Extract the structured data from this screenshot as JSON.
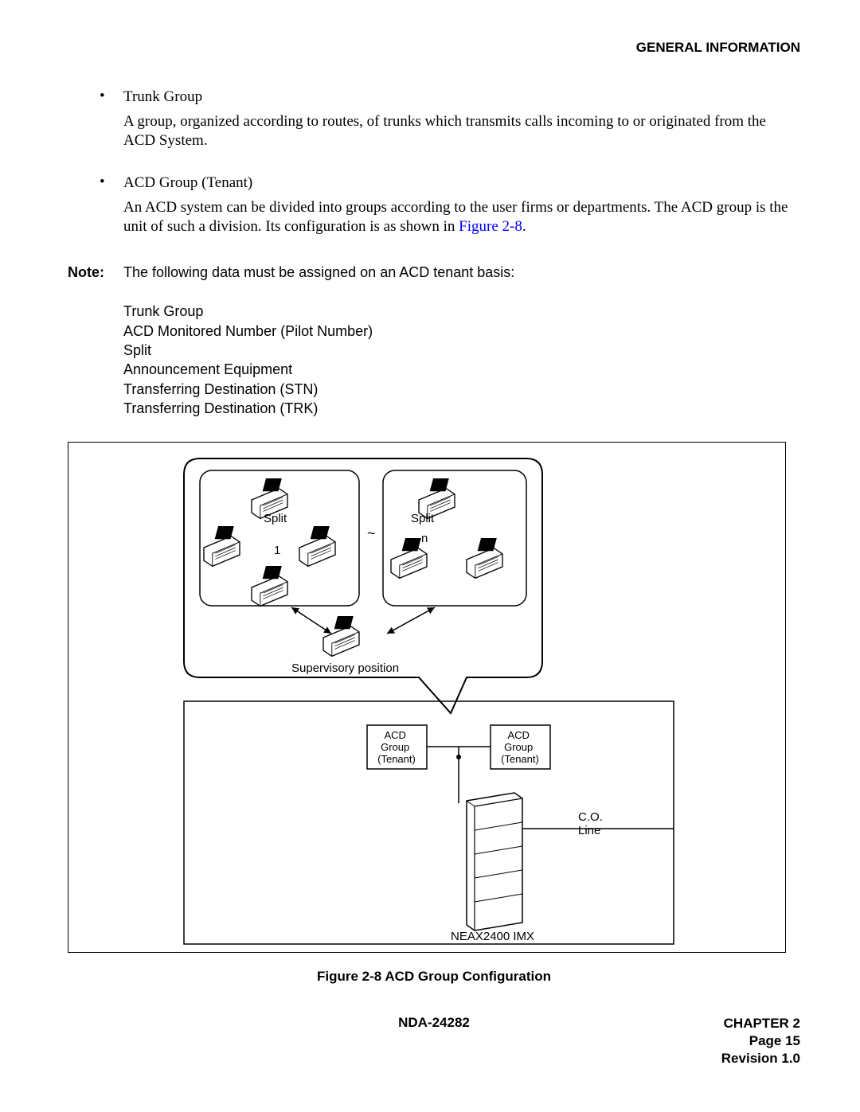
{
  "header": {
    "section_title": "GENERAL INFORMATION"
  },
  "bullets": [
    {
      "label": "Trunk Group",
      "desc_pre": "A group, organized according to routes, of trunks which transmits calls incoming to or originated from the ACD System.",
      "desc_link": "",
      "desc_post": ""
    },
    {
      "label": "ACD Group (Tenant)",
      "desc_pre": "An ACD system can be divided into groups according to the user firms or departments. The ACD group is the unit of such a division. Its configuration is as shown in ",
      "desc_link": "Figure 2-8",
      "desc_post": "."
    }
  ],
  "note": {
    "label": "Note:",
    "intro": "The following data must be assigned on an ACD tenant basis:",
    "items": [
      "Trunk Group",
      "ACD Monitored Number (Pilot Number)",
      "Split",
      "Announcement Equipment",
      "Transferring Destination (STN)",
      "Transferring Destination (TRK)"
    ]
  },
  "diagram": {
    "split1": "Split",
    "split1_num": "1",
    "splitn": "Split",
    "splitn_num": "n",
    "tilde": "~",
    "supervisory": "Supervisory position",
    "acd_group1": "ACD\nGroup\n(Tenant)",
    "acd_group2": "ACD\nGroup\n(Tenant)",
    "co_line": "C.O.\nLine",
    "neax": "NEAX2400 IMX"
  },
  "figure_caption": "Figure 2-8   ACD Group Configuration",
  "footer": {
    "doc_id": "NDA-24282",
    "chapter": "CHAPTER 2",
    "page": "Page 15",
    "revision": "Revision 1.0"
  }
}
